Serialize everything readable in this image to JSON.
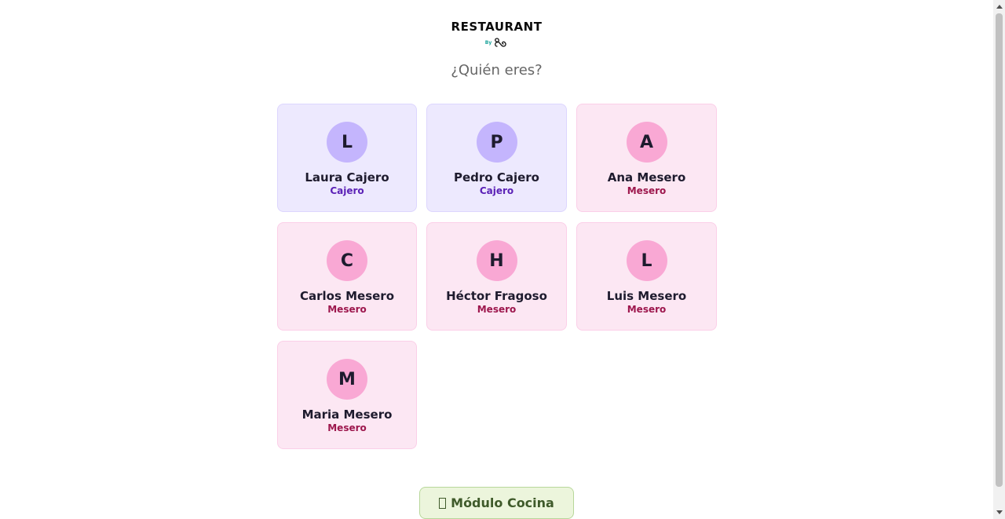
{
  "header": {
    "logo_title": "RESTAURANT",
    "logo_by": "By",
    "question": "¿Quién eres?"
  },
  "users": [
    {
      "initial": "L",
      "name": "Laura Cajero",
      "role": "Cajero",
      "type": "cajero"
    },
    {
      "initial": "P",
      "name": "Pedro Cajero",
      "role": "Cajero",
      "type": "cajero"
    },
    {
      "initial": "A",
      "name": "Ana Mesero",
      "role": "Mesero",
      "type": "mesero"
    },
    {
      "initial": "C",
      "name": "Carlos Mesero",
      "role": "Mesero",
      "type": "mesero"
    },
    {
      "initial": "H",
      "name": "Héctor Fragoso",
      "role": "Mesero",
      "type": "mesero"
    },
    {
      "initial": "L",
      "name": "Luis Mesero",
      "role": "Mesero",
      "type": "mesero"
    },
    {
      "initial": "M",
      "name": "Maria Mesero",
      "role": "Mesero",
      "type": "mesero"
    }
  ],
  "footer": {
    "kitchen_button_label": "Módulo Cocina",
    "kitchen_button_icon": "box-icon"
  },
  "colors": {
    "cajero_bg": "#ede9fe",
    "cajero_avatar": "#c4b5fd",
    "cajero_role": "#5b21b6",
    "mesero_bg": "#fce7f3",
    "mesero_avatar": "#f9a8d4",
    "mesero_role": "#9d174d",
    "kitchen_bg": "#ecf5dc"
  }
}
